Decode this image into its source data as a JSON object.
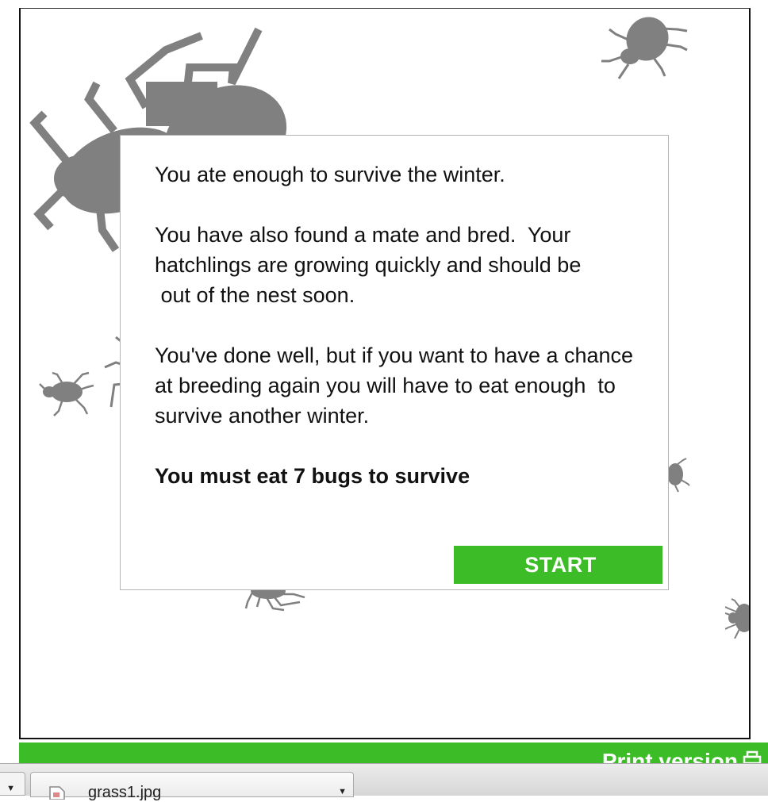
{
  "dialog": {
    "paragraphs": [
      "You ate enough to survive the winter.",
      "You have also found a mate and bred.  Your hatchlings are growing quickly and should be\n out of the nest soon.",
      "You've done well, but if you want to have a chance at breeding again you will have to eat enough  to survive another winter."
    ],
    "goal": "You must eat 7 bugs to survive",
    "start_label": "START"
  },
  "footer": {
    "print_label": "Print version"
  },
  "download_shelf": {
    "file_name": "grass1.jpg"
  },
  "colors": {
    "accent_green": "#3cbd27",
    "bug_gray": "#808080"
  },
  "icons": [
    "bug-icon",
    "printer-icon",
    "file-icon",
    "dropdown-arrow-icon"
  ]
}
